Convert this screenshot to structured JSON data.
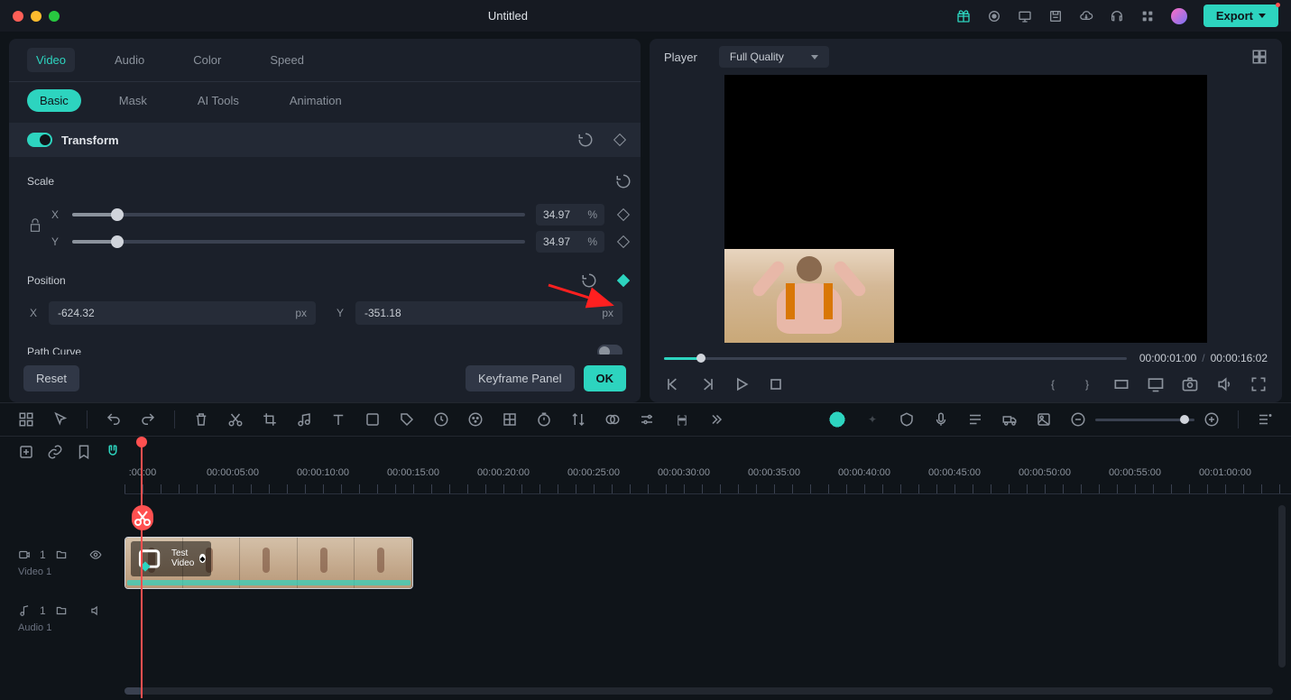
{
  "title": "Untitled",
  "export": "Export",
  "panel": {
    "tabs1": [
      "Video",
      "Audio",
      "Color",
      "Speed"
    ],
    "tabs1_active": 0,
    "tabs2": [
      "Basic",
      "Mask",
      "AI Tools",
      "Animation"
    ],
    "tabs2_active": 0,
    "transform_label": "Transform",
    "scale_label": "Scale",
    "scale_x_axis": "X",
    "scale_y_axis": "Y",
    "scale_x_val": "34.97",
    "scale_y_val": "34.97",
    "scale_unit": "%",
    "position_label": "Position",
    "pos_x_axis": "X",
    "pos_y_axis": "Y",
    "pos_x_val": "-624.32",
    "pos_y_val": "-351.18",
    "pos_unit": "px",
    "pathcurve_label": "Path Curve",
    "reset": "Reset",
    "keyframe_panel": "Keyframe Panel",
    "ok": "OK"
  },
  "player": {
    "label": "Player",
    "quality": "Full Quality",
    "time_cur": "00:00:01:00",
    "time_dur": "00:00:16:02"
  },
  "timeline": {
    "labels": [
      ":00:00",
      "00:00:05:00",
      "00:00:10:00",
      "00:00:15:00",
      "00:00:20:00",
      "00:00:25:00",
      "00:00:30:00",
      "00:00:35:00",
      "00:00:40:00",
      "00:00:45:00",
      "00:00:50:00",
      "00:00:55:00",
      "00:01:00:00"
    ],
    "video_track_n": "1",
    "video_track_name": "Video 1",
    "audio_track_n": "1",
    "audio_track_name": "Audio 1",
    "clip_name": "Test Video"
  },
  "colors": {
    "accent": "#2dd4bf",
    "red": "#ff5050"
  }
}
